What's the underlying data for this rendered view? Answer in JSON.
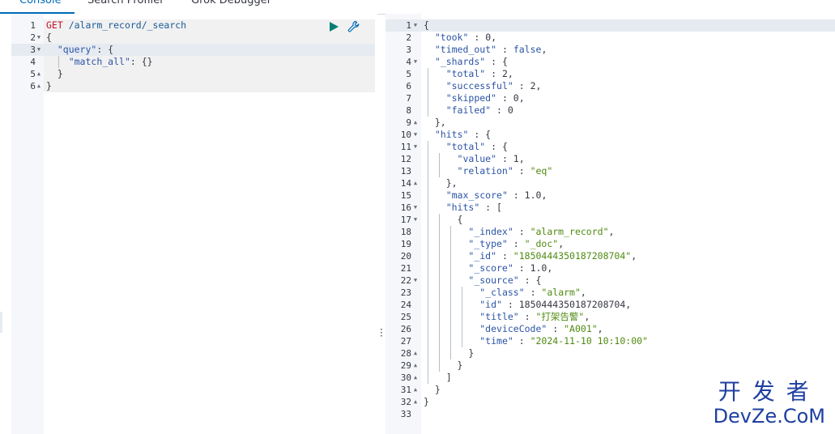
{
  "tabs": [
    {
      "label": "Console",
      "active": true
    },
    {
      "label": "Search Profiler",
      "active": false
    },
    {
      "label": "Grok Debugger",
      "active": false
    }
  ],
  "request": {
    "method": "GET",
    "path": "/alarm_record/_search",
    "lines": [
      {
        "n": "1",
        "fold": "",
        "tokens": [
          [
            "m",
            "GET "
          ],
          [
            "u",
            "/alarm_record/_search"
          ]
        ]
      },
      {
        "n": "2",
        "fold": "▼",
        "tokens": [
          [
            "p",
            "{"
          ]
        ]
      },
      {
        "n": "3",
        "fold": "▼",
        "tokens": [
          [
            "p",
            "  "
          ],
          [
            "k",
            "\"query\""
          ],
          [
            "p",
            ": {"
          ]
        ]
      },
      {
        "n": "4",
        "fold": "",
        "tokens": [
          [
            "p",
            "    "
          ],
          [
            "k",
            "\"match_all\""
          ],
          [
            "p",
            ": {}"
          ]
        ]
      },
      {
        "n": "5",
        "fold": "▲",
        "tokens": [
          [
            "p",
            "  }"
          ]
        ]
      },
      {
        "n": "6",
        "fold": "▲",
        "tokens": [
          [
            "p",
            "}"
          ]
        ]
      }
    ]
  },
  "response": {
    "lines": [
      {
        "n": "1",
        "fold": "▼",
        "tokens": [
          [
            "p",
            "{"
          ]
        ]
      },
      {
        "n": "2",
        "fold": "",
        "tokens": [
          [
            "p",
            "  "
          ],
          [
            "k",
            "\"took\""
          ],
          [
            "p",
            " : "
          ],
          [
            "n",
            "0"
          ],
          [
            "p",
            ","
          ]
        ]
      },
      {
        "n": "3",
        "fold": "",
        "tokens": [
          [
            "p",
            "  "
          ],
          [
            "k",
            "\"timed_out\""
          ],
          [
            "p",
            " : "
          ],
          [
            "b",
            "false"
          ],
          [
            "p",
            ","
          ]
        ]
      },
      {
        "n": "4",
        "fold": "▼",
        "tokens": [
          [
            "p",
            "  "
          ],
          [
            "k",
            "\"_shards\""
          ],
          [
            "p",
            " : {"
          ]
        ]
      },
      {
        "n": "5",
        "fold": "",
        "tokens": [
          [
            "p",
            "    "
          ],
          [
            "k",
            "\"total\""
          ],
          [
            "p",
            " : "
          ],
          [
            "n",
            "2"
          ],
          [
            "p",
            ","
          ]
        ]
      },
      {
        "n": "6",
        "fold": "",
        "tokens": [
          [
            "p",
            "    "
          ],
          [
            "k",
            "\"successful\""
          ],
          [
            "p",
            " : "
          ],
          [
            "n",
            "2"
          ],
          [
            "p",
            ","
          ]
        ]
      },
      {
        "n": "7",
        "fold": "",
        "tokens": [
          [
            "p",
            "    "
          ],
          [
            "k",
            "\"skipped\""
          ],
          [
            "p",
            " : "
          ],
          [
            "n",
            "0"
          ],
          [
            "p",
            ","
          ]
        ]
      },
      {
        "n": "8",
        "fold": "",
        "tokens": [
          [
            "p",
            "    "
          ],
          [
            "k",
            "\"failed\""
          ],
          [
            "p",
            " : "
          ],
          [
            "n",
            "0"
          ]
        ]
      },
      {
        "n": "9",
        "fold": "▲",
        "tokens": [
          [
            "p",
            "  },"
          ]
        ]
      },
      {
        "n": "10",
        "fold": "▼",
        "tokens": [
          [
            "p",
            "  "
          ],
          [
            "k",
            "\"hits\""
          ],
          [
            "p",
            " : {"
          ]
        ]
      },
      {
        "n": "11",
        "fold": "▼",
        "tokens": [
          [
            "p",
            "    "
          ],
          [
            "k",
            "\"total\""
          ],
          [
            "p",
            " : {"
          ]
        ]
      },
      {
        "n": "12",
        "fold": "",
        "tokens": [
          [
            "p",
            "      "
          ],
          [
            "k",
            "\"value\""
          ],
          [
            "p",
            " : "
          ],
          [
            "n",
            "1"
          ],
          [
            "p",
            ","
          ]
        ]
      },
      {
        "n": "13",
        "fold": "",
        "tokens": [
          [
            "p",
            "      "
          ],
          [
            "k",
            "\"relation\""
          ],
          [
            "p",
            " : "
          ],
          [
            "s",
            "\"eq\""
          ]
        ]
      },
      {
        "n": "14",
        "fold": "▲",
        "tokens": [
          [
            "p",
            "    },"
          ]
        ]
      },
      {
        "n": "15",
        "fold": "",
        "tokens": [
          [
            "p",
            "    "
          ],
          [
            "k",
            "\"max_score\""
          ],
          [
            "p",
            " : "
          ],
          [
            "n",
            "1.0"
          ],
          [
            "p",
            ","
          ]
        ]
      },
      {
        "n": "16",
        "fold": "▼",
        "tokens": [
          [
            "p",
            "    "
          ],
          [
            "k",
            "\"hits\""
          ],
          [
            "p",
            " : ["
          ]
        ]
      },
      {
        "n": "17",
        "fold": "▼",
        "tokens": [
          [
            "p",
            "      {"
          ]
        ]
      },
      {
        "n": "18",
        "fold": "",
        "tokens": [
          [
            "p",
            "        "
          ],
          [
            "k",
            "\"_index\""
          ],
          [
            "p",
            " : "
          ],
          [
            "s",
            "\"alarm_record\""
          ],
          [
            "p",
            ","
          ]
        ]
      },
      {
        "n": "19",
        "fold": "",
        "tokens": [
          [
            "p",
            "        "
          ],
          [
            "k",
            "\"_type\""
          ],
          [
            "p",
            " : "
          ],
          [
            "s",
            "\"_doc\""
          ],
          [
            "p",
            ","
          ]
        ]
      },
      {
        "n": "20",
        "fold": "",
        "tokens": [
          [
            "p",
            "        "
          ],
          [
            "k",
            "\"_id\""
          ],
          [
            "p",
            " : "
          ],
          [
            "s",
            "\"1850444350187208704\""
          ],
          [
            "p",
            ","
          ]
        ]
      },
      {
        "n": "21",
        "fold": "",
        "tokens": [
          [
            "p",
            "        "
          ],
          [
            "k",
            "\"_score\""
          ],
          [
            "p",
            " : "
          ],
          [
            "n",
            "1.0"
          ],
          [
            "p",
            ","
          ]
        ]
      },
      {
        "n": "22",
        "fold": "▼",
        "tokens": [
          [
            "p",
            "        "
          ],
          [
            "k",
            "\"_source\""
          ],
          [
            "p",
            " : {"
          ]
        ]
      },
      {
        "n": "23",
        "fold": "",
        "tokens": [
          [
            "p",
            "          "
          ],
          [
            "k",
            "\"_class\""
          ],
          [
            "p",
            " : "
          ],
          [
            "s",
            "\"alarm\""
          ],
          [
            "p",
            ","
          ]
        ]
      },
      {
        "n": "24",
        "fold": "",
        "tokens": [
          [
            "p",
            "          "
          ],
          [
            "k",
            "\"id\""
          ],
          [
            "p",
            " : "
          ],
          [
            "n",
            "1850444350187208704"
          ],
          [
            "p",
            ","
          ]
        ]
      },
      {
        "n": "25",
        "fold": "",
        "tokens": [
          [
            "p",
            "          "
          ],
          [
            "k",
            "\"title\""
          ],
          [
            "p",
            " : "
          ],
          [
            "s",
            "\"打架告警\""
          ],
          [
            "p",
            ","
          ]
        ]
      },
      {
        "n": "26",
        "fold": "",
        "tokens": [
          [
            "p",
            "          "
          ],
          [
            "k",
            "\"deviceCode\""
          ],
          [
            "p",
            " : "
          ],
          [
            "s",
            "\"A001\""
          ],
          [
            "p",
            ","
          ]
        ]
      },
      {
        "n": "27",
        "fold": "",
        "tokens": [
          [
            "p",
            "          "
          ],
          [
            "k",
            "\"time\""
          ],
          [
            "p",
            " : "
          ],
          [
            "s",
            "\"2024-11-10 10:10:00\""
          ]
        ]
      },
      {
        "n": "28",
        "fold": "▲",
        "tokens": [
          [
            "p",
            "        }"
          ]
        ]
      },
      {
        "n": "29",
        "fold": "▲",
        "tokens": [
          [
            "p",
            "      }"
          ]
        ]
      },
      {
        "n": "30",
        "fold": "▲",
        "tokens": [
          [
            "p",
            "    ]"
          ]
        ]
      },
      {
        "n": "31",
        "fold": "▲",
        "tokens": [
          [
            "p",
            "  }"
          ]
        ]
      },
      {
        "n": "32",
        "fold": "▲",
        "tokens": [
          [
            "p",
            "}"
          ]
        ]
      },
      {
        "n": "33",
        "fold": "",
        "tokens": []
      }
    ]
  },
  "watermark": {
    "cn": "开发者",
    "en": "DevZe.CoM"
  },
  "colors": {
    "accent": "#006bb8",
    "run_button": "#017d73"
  },
  "icons": {
    "run": "play-icon",
    "settings": "wrench-icon",
    "resize": "vertical-dots-icon"
  }
}
